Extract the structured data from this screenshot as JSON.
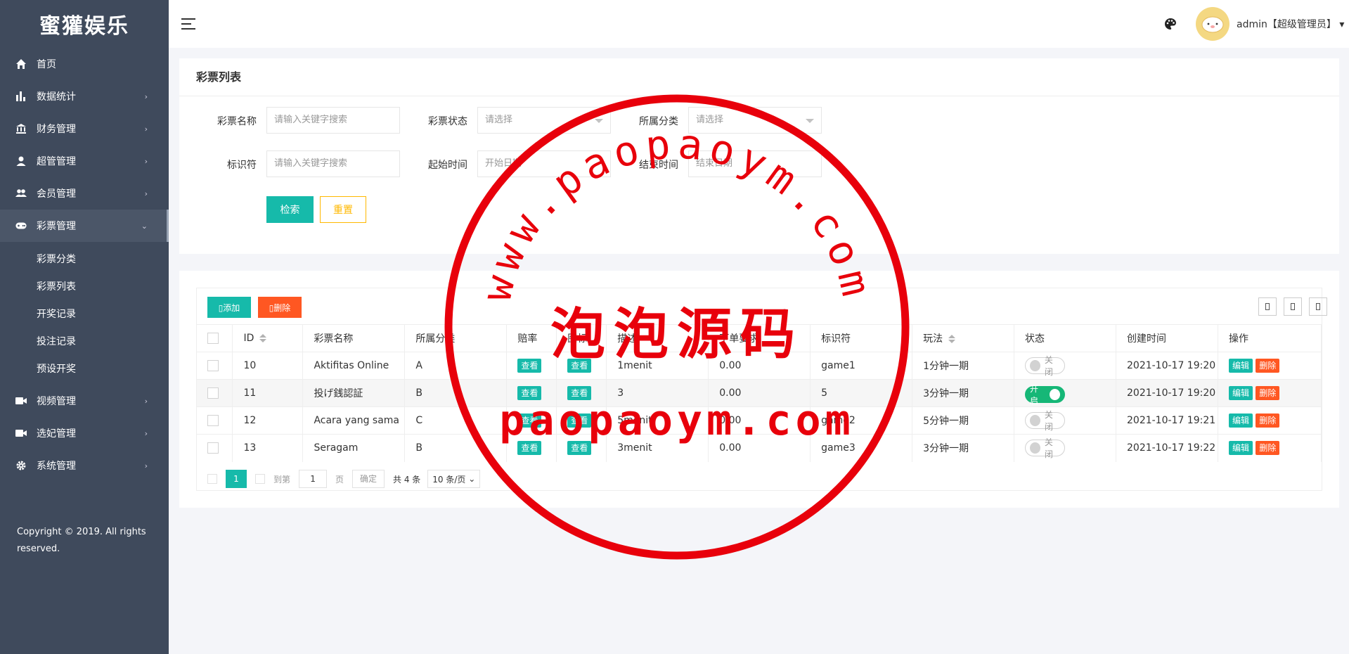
{
  "app": {
    "brand": "蜜獾娱乐"
  },
  "sidebar": {
    "items": [
      {
        "label": "首页",
        "icon": "home-icon",
        "arrow": ""
      },
      {
        "label": "数据统计",
        "icon": "bar-chart-icon",
        "arrow": "›"
      },
      {
        "label": "财务管理",
        "icon": "bank-icon",
        "arrow": "›"
      },
      {
        "label": "超管管理",
        "icon": "user-icon",
        "arrow": "›"
      },
      {
        "label": "会员管理",
        "icon": "users-icon",
        "arrow": "›"
      },
      {
        "label": "彩票管理",
        "icon": "gamepad-icon",
        "arrow": "⌄"
      },
      {
        "label": "视频管理",
        "icon": "video-icon",
        "arrow": "›"
      },
      {
        "label": "选妃管理",
        "icon": "video-icon",
        "arrow": "›"
      },
      {
        "label": "系统管理",
        "icon": "gear-icon",
        "arrow": "›"
      }
    ],
    "subitems": [
      "彩票分类",
      "彩票列表",
      "开奖记录",
      "投注记录",
      "预设开奖"
    ],
    "copyright": "Copyright © 2019. All rights reserved."
  },
  "header": {
    "user": "admin【超级管理员】"
  },
  "search": {
    "title": "彩票列表",
    "fields": {
      "name_label": "彩票名称",
      "name_placeholder": "请输入关键字搜索",
      "status_label": "彩票状态",
      "status_placeholder": "请选择",
      "category_label": "所属分类",
      "category_placeholder": "请选择",
      "key_label": "标识符",
      "key_placeholder": "请输入关键字搜索",
      "start_label": "起始时间",
      "start_placeholder": "开始日期",
      "end_label": "结束时间",
      "end_placeholder": "结束日期"
    },
    "search_btn": "检索",
    "reset_btn": "重置"
  },
  "table": {
    "add_btn": "添加",
    "delete_btn": "删除",
    "headers": [
      "ID",
      "彩票名称",
      "所属分类",
      "赔率",
      "图标",
      "描述",
      "下单要求",
      "标识符",
      "玩法",
      "状态",
      "创建时间",
      "操作"
    ],
    "view_label": "查看",
    "edit_label": "编辑",
    "remove_label": "删除",
    "rows": [
      {
        "id": "10",
        "name": "Aktifitas Online",
        "category": "A",
        "desc": "1menit",
        "req": "0.00",
        "key": "game1",
        "play": "1分钟一期",
        "status": "关闭",
        "on": false,
        "created": "2021-10-17 19:20"
      },
      {
        "id": "11",
        "name": "投げ銭認証",
        "category": "B",
        "desc": "3",
        "req": "0.00",
        "key": "5",
        "play": "3分钟一期",
        "status": "开启",
        "on": true,
        "created": "2021-10-17 19:20"
      },
      {
        "id": "12",
        "name": "Acara yang sama",
        "category": "C",
        "desc": "5menit",
        "req": "0.00",
        "key": "game2",
        "play": "5分钟一期",
        "status": "关闭",
        "on": false,
        "created": "2021-10-17 19:21"
      },
      {
        "id": "13",
        "name": "Seragam",
        "category": "B",
        "desc": "3menit",
        "req": "0.00",
        "key": "game3",
        "play": "3分钟一期",
        "status": "关闭",
        "on": false,
        "created": "2021-10-17 19:22"
      }
    ]
  },
  "pager": {
    "current": "1",
    "goto_label": "到第",
    "goto_value": "1",
    "page_unit": "页",
    "ok_label": "确定",
    "total": "共 4 条",
    "page_size": "10 条/页"
  },
  "watermark": {
    "top_text": "www.paopaoym.com",
    "center_text": "泡泡源码",
    "bottom_text": "paopaoym.com",
    "color": "#e8000b"
  }
}
